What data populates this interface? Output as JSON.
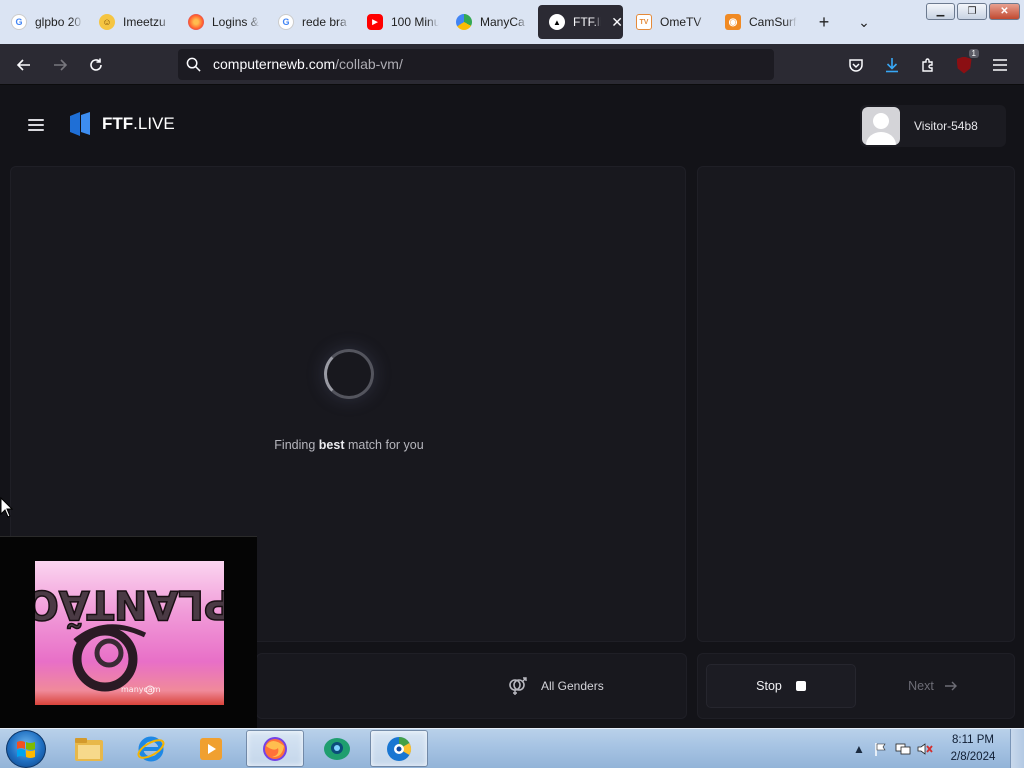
{
  "browser": {
    "tabs": [
      {
        "label": "glpbo 20",
        "favicon": "google-icon",
        "active": false
      },
      {
        "label": "Imeetzu",
        "favicon": "imeetzu-icon",
        "active": false
      },
      {
        "label": "Logins &",
        "favicon": "firefox-icon",
        "active": false
      },
      {
        "label": "rede bra",
        "favicon": "google-icon",
        "active": false
      },
      {
        "label": "100 Minu",
        "favicon": "youtube-icon",
        "active": false
      },
      {
        "label": "ManyCa",
        "favicon": "manycam-icon",
        "active": false
      },
      {
        "label": "FTF.li",
        "favicon": "ftf-icon",
        "active": true
      },
      {
        "label": "OmeTV",
        "favicon": "ometv-icon",
        "active": false
      },
      {
        "label": "CamSurf",
        "favicon": "camsurf-icon",
        "active": false
      }
    ],
    "url": {
      "host": "computernewb.com",
      "path": "/collab-vm/"
    },
    "extension_badge": "1"
  },
  "site": {
    "logo": {
      "bold": "FTF",
      "rest": ".LIVE"
    },
    "visitor_name": "Visitor-54b8",
    "status": {
      "prefix": "Finding ",
      "bold": "best",
      "suffix": " match for you"
    },
    "gender_filter": "All Genders",
    "stop_label": "Stop",
    "next_label": "Next"
  },
  "cam_preview": {
    "watermark": "manycam"
  },
  "taskbar": {
    "apps": [
      "explorer",
      "internet-explorer",
      "media-player",
      "firefox",
      "camfrog",
      "manycam"
    ],
    "active_apps": [
      "firefox",
      "manycam"
    ],
    "clock_time": "8:11 PM",
    "clock_date": "2/8/2024"
  },
  "colors": {
    "accent_blue": "#1f6fd6",
    "page_bg": "#131318",
    "panel_bg": "#18181e",
    "browser_chrome": "#2b2a33",
    "tab_strip": "#dbe4f3"
  }
}
